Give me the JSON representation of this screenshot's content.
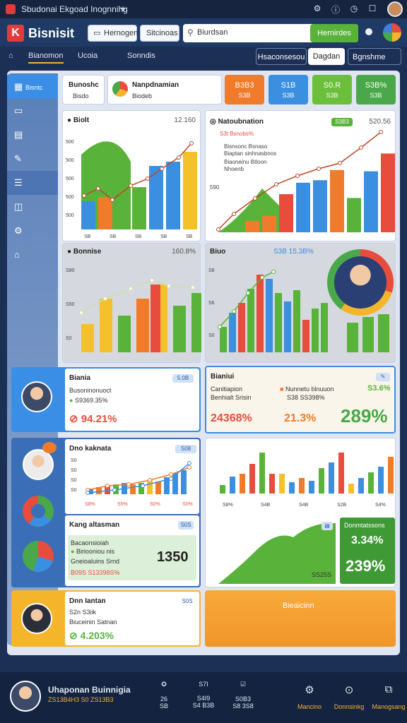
{
  "window": {
    "title": "Sbudonai Ekgoad Inognnihg"
  },
  "header": {
    "logo": "Bisnisit",
    "tab1": "Hernogen",
    "tab2": "Sitcinoas",
    "search_placeholder": "Biurdsan",
    "search_button": "Hernirdes"
  },
  "nav": {
    "home_label": "Bianomon",
    "item2": "Ucoia",
    "item3": "Sonndis",
    "btn1": "Hsaconsesou",
    "btn2": "Dagdan",
    "btn3": "Bgnshme"
  },
  "sidebar": {
    "item1": "Bisntc"
  },
  "topcard": {
    "title": "Bunoshc",
    "subtitle": "Bisdo",
    "card2_title": "Nanpdnamian",
    "card2_sub": "Biodeb"
  },
  "kpis": [
    {
      "v1": "B3B3",
      "v2": "S3B",
      "color": "#f07b2a"
    },
    {
      "v1": "S1B",
      "v2": "S3B",
      "color": "#3b8fe0"
    },
    {
      "v1": "S0.R",
      "v2": "S3B",
      "color": "#6cbf3a"
    },
    {
      "v1": "S3B%",
      "v2": "S3B",
      "color": "#4aa84a"
    }
  ],
  "chart1": {
    "title": "Biolt",
    "value": "12.160",
    "yticks": [
      "500",
      "500",
      "500",
      "500",
      "500"
    ],
    "xticks": [
      "SB",
      "SB",
      "SB",
      "SB",
      "SB"
    ]
  },
  "chart2": {
    "title": "Natoubnation",
    "value": "520.56",
    "legend_badge": "S3B3",
    "legend": [
      "Bisnsonc Bsnaso",
      "Biaptan sinhnasbnos",
      "Biaoneinu Btloon",
      "Nhoenb"
    ],
    "ytick": "590",
    "top_value": "S3t Bsnobs%"
  },
  "chart3": {
    "title": "Bonnise",
    "value": "160.8%",
    "yticks": [
      "S80",
      "S50",
      "S0"
    ]
  },
  "chart4": {
    "title": "Biuo",
    "value": "S3B 15.3B%",
    "yticks": [
      "S8",
      "S6",
      "S0"
    ]
  },
  "card_a": {
    "title": "Biania",
    "tag": "5.0B",
    "line1": "Busoninonuoct",
    "line2": "S9369.35%",
    "big": "94.21%"
  },
  "card_b": {
    "title": "Bianiui",
    "line1": "Canitiapion",
    "line2": "Benhialt Srisin",
    "line3": "Nunnetu blnuuon",
    "line4": "S38 SS398%",
    "pct1": "S3.6%",
    "v1": "24368%",
    "v2": "21.3%",
    "v3": "289%"
  },
  "card_c": {
    "title": "Dno kaknata",
    "tag": "S08",
    "yticks": [
      "S0",
      "S0",
      "S0",
      "S0"
    ],
    "xticks": [
      "S8%",
      "S5%",
      "S0%",
      "S0%"
    ]
  },
  "card_d": {
    "title": "Kang altasman",
    "tag": "S0S",
    "line1": "Bacaonsioiah",
    "line2": "Biriooniou nis",
    "line3": "Gneioaluins Srnd",
    "big": "1350",
    "row": "B09S S13398S%"
  },
  "chart5": {
    "xticks": [
      "S8%",
      "S4B",
      "S4B",
      "S2B",
      "S4%"
    ]
  },
  "area_card": {
    "badge": "S04",
    "label": "SS25S",
    "green_title": "Donmtatssons",
    "pct1": "3.34%",
    "pct2": "239%"
  },
  "card_e": {
    "title": "Dnn Iantan",
    "tag": "S0S",
    "line1": "S2n S3iik",
    "line2": "Biuceinin Satnan",
    "big": "4.203%"
  },
  "banner": {
    "label": "Bieaicinn"
  },
  "footer": {
    "name": "Uhaponan Buinnigia",
    "sub": "ZS13B4H3 S0 ZS13B3",
    "stats": [
      {
        "icon": "✪",
        "v1": "26",
        "v2": "SB"
      },
      {
        "icon": "S7I",
        "v1": "S4I9",
        "v2": "S4 B3B"
      },
      {
        "icon": "☑",
        "v1": "S0B3",
        "v2": "S8 3S8"
      }
    ],
    "actions": [
      {
        "icon": "⚙",
        "label": "Mancino"
      },
      {
        "icon": "⊙",
        "label": "Donnsinkg"
      },
      {
        "icon": "⧉",
        "label": "Manogsang"
      }
    ]
  },
  "colors": {
    "green": "#59b33a",
    "blue": "#3b8fe0",
    "orange": "#f07b2a",
    "yellow": "#f5c12b",
    "red": "#e84c3d"
  }
}
